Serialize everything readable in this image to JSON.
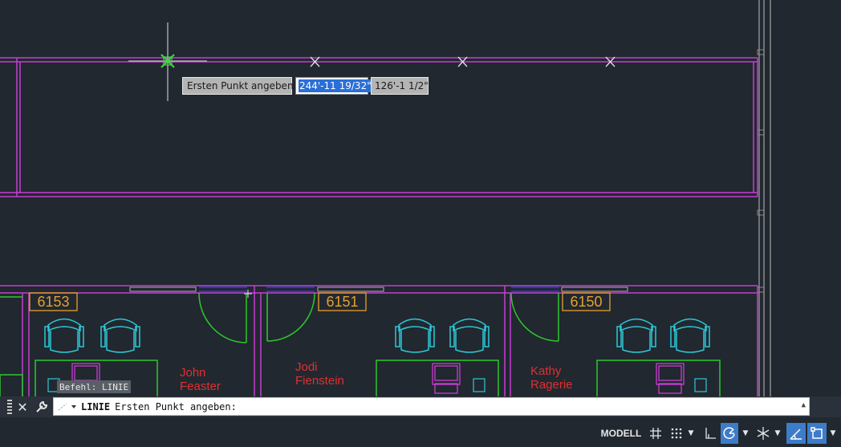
{
  "dynamic_input": {
    "label": "Ersten Punkt angeben:",
    "x_value": "244'-11 19/32\"",
    "y_value": "126'-1 1/2\""
  },
  "rooms": [
    {
      "number": "6153",
      "occupant_line1": "John",
      "occupant_line2": "Feaster"
    },
    {
      "number": "6151",
      "occupant_line1": "Jodi",
      "occupant_line2": "Fienstein"
    },
    {
      "number": "6150",
      "occupant_line1": "Kathy",
      "occupant_line2": "Ragerie"
    }
  ],
  "command_history": "Befehl: LINIE",
  "command_line": {
    "command": "LINIE",
    "prompt": "Ersten Punkt angeben:"
  },
  "status_bar": {
    "model_label": "MODELL"
  },
  "colors": {
    "background": "#212830",
    "walls": "#c83cd2",
    "doors": "#2dc82d",
    "furniture": "#2ec8d8",
    "room_number": "#e6a02a",
    "occupant_names": "#e03030",
    "door_frames": "#2a3aa8",
    "windows": "#8a8a8a"
  },
  "icons": {
    "close": "close-icon",
    "customize": "wrench-icon",
    "grid": "grid-icon",
    "snap": "snap-icon",
    "ortho": "ortho-icon",
    "polar": "polar-tracking-icon",
    "isodraft": "isometric-icon",
    "osnap_tracking": "object-snap-tracking-icon",
    "annotation": "annotation-icon"
  }
}
